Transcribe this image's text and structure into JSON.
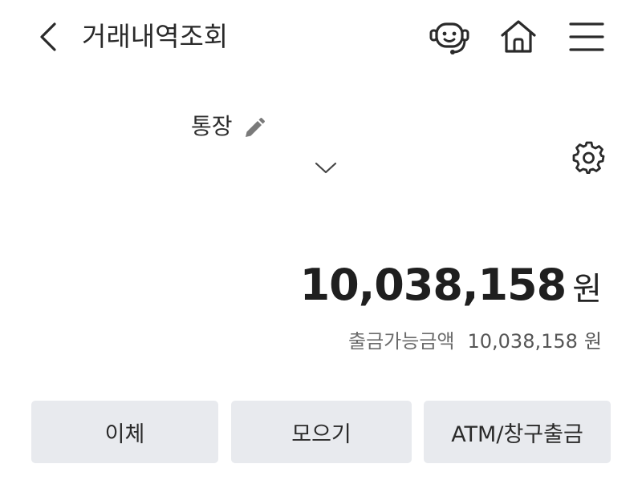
{
  "header": {
    "title": "거래내역조회",
    "icons": {
      "back": "chevron-left-icon",
      "chat": "chatbot-icon",
      "home": "home-icon",
      "menu": "hamburger-menu-icon"
    }
  },
  "account": {
    "name": "통장",
    "icons": {
      "edit": "pencil-icon",
      "dropdown": "chevron-down-icon",
      "settings": "gear-icon"
    }
  },
  "balance": {
    "amount": "10,038,158",
    "unit": "원"
  },
  "available": {
    "label": "출금가능금액",
    "amount": "10,038,158",
    "unit": "원"
  },
  "actions": [
    {
      "label": "이체"
    },
    {
      "label": "모으기"
    },
    {
      "label": "ATM/창구출금"
    }
  ],
  "colors": {
    "button_bg": "#e8eaee",
    "text_primary": "#222222",
    "text_secondary": "#6b6b6b",
    "icon_stroke": "#2a2a2a",
    "pencil": "#7a7a7a"
  }
}
